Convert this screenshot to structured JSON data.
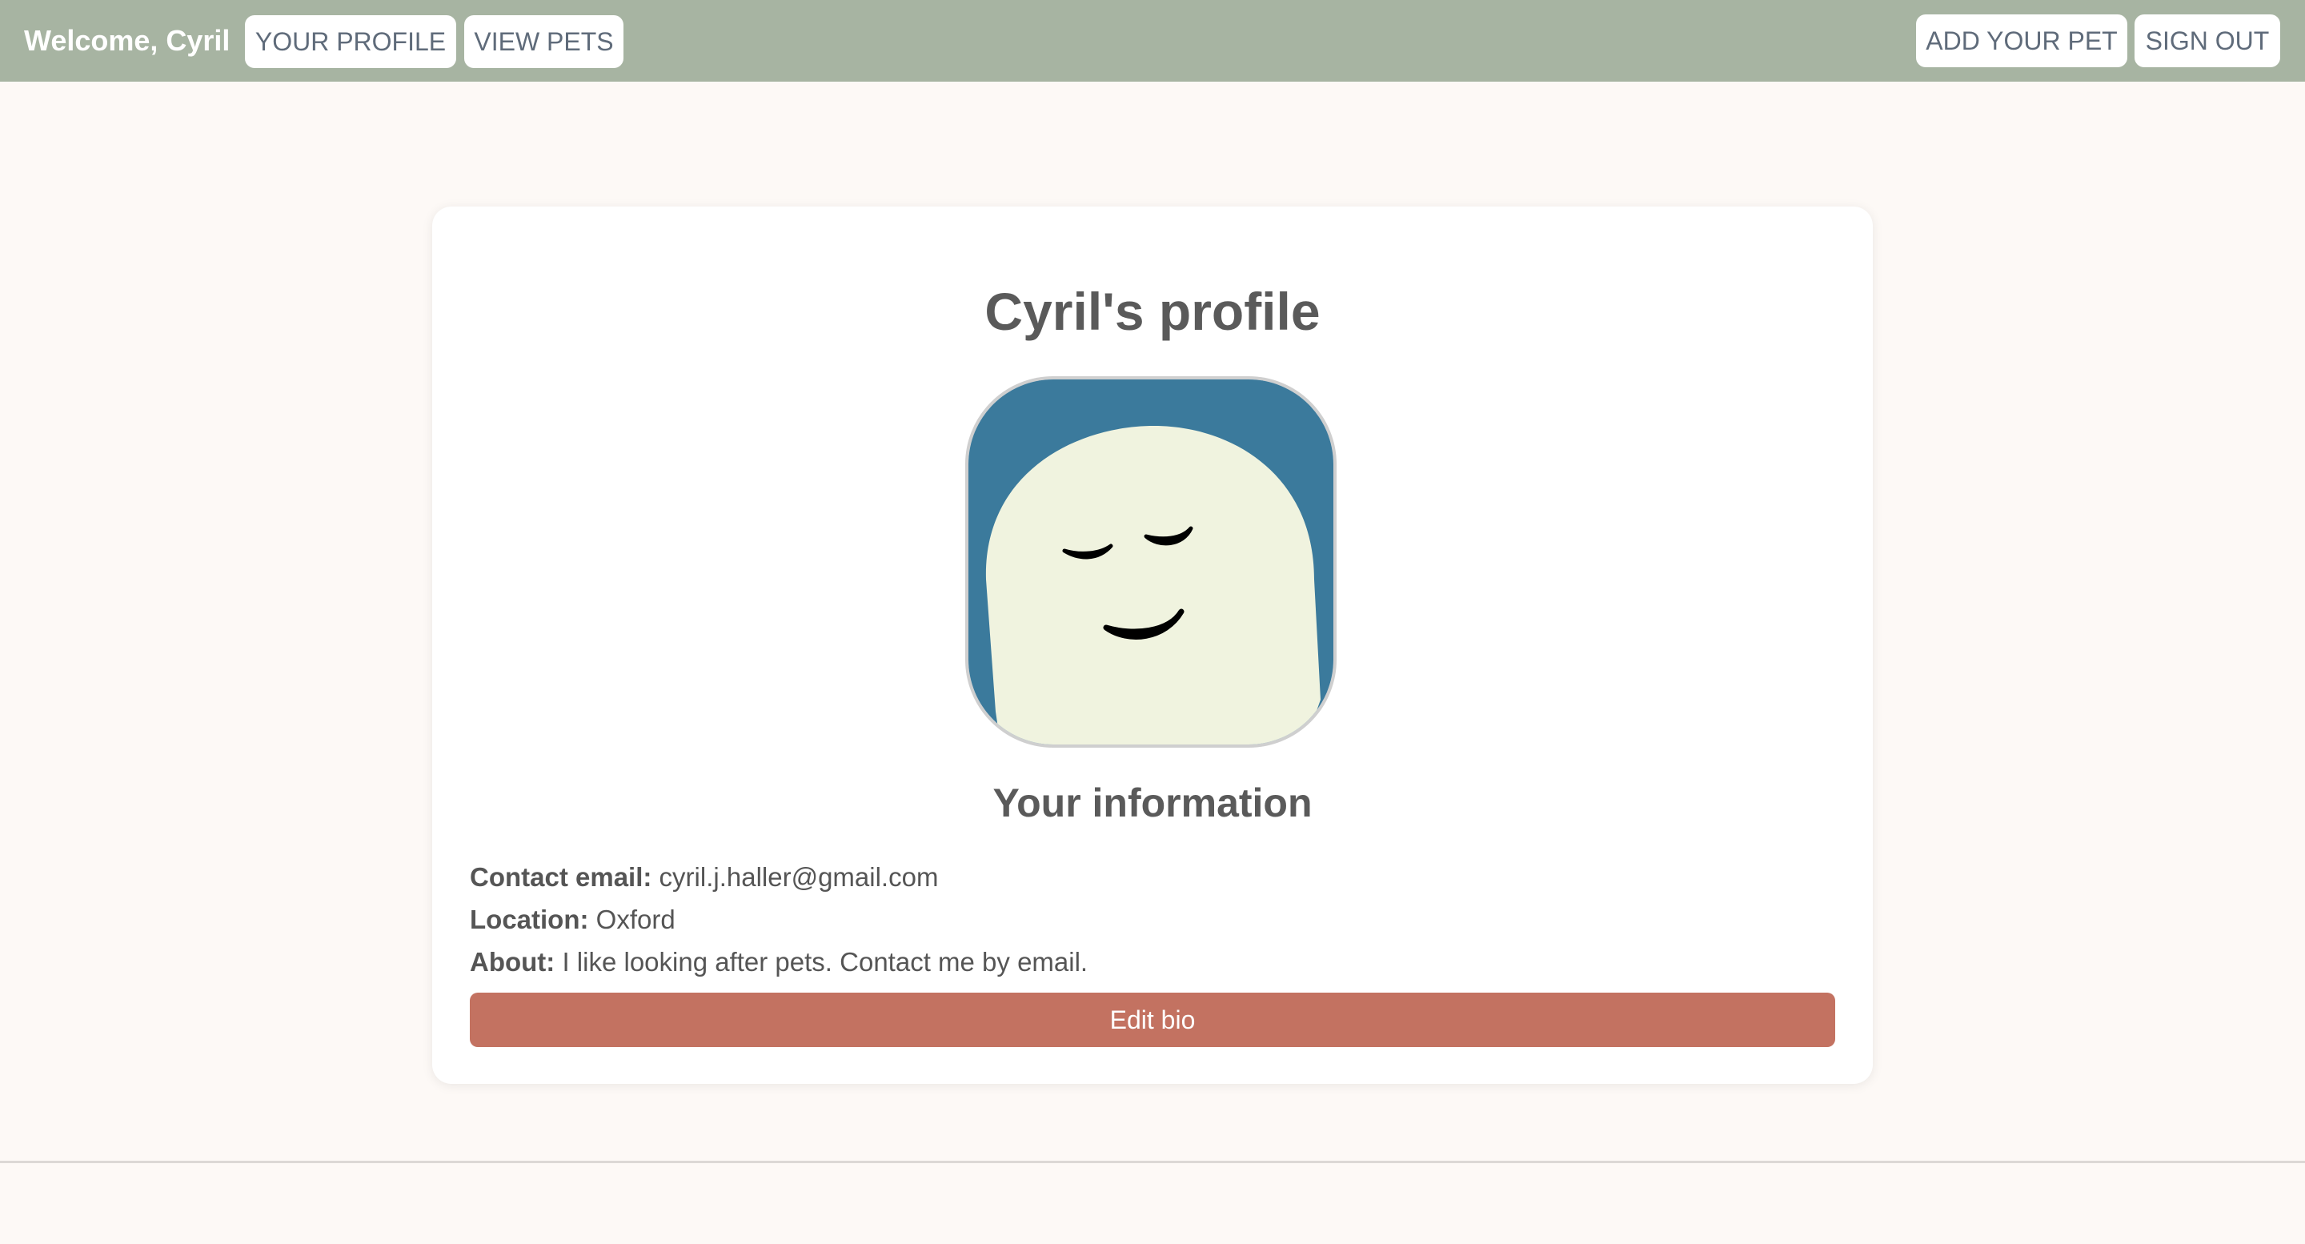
{
  "header": {
    "welcome": "Welcome, Cyril",
    "nav_left": [
      "YOUR PROFILE",
      "VIEW PETS"
    ],
    "nav_right": [
      "ADD YOUR PET",
      "SIGN OUT"
    ],
    "background_color": "#a7b4a2"
  },
  "profile": {
    "title": "Cyril's profile",
    "avatar_icon": "smiling-face-icon",
    "section_heading": "Your information",
    "fields": [
      {
        "label": "Contact email:",
        "value": "cyril.j.haller@gmail.com"
      },
      {
        "label": "Location:",
        "value": "Oxford"
      },
      {
        "label": "About:",
        "value": "I like looking after pets. Contact me by email."
      }
    ],
    "edit_button": "Edit bio",
    "edit_button_color": "#c37261"
  }
}
